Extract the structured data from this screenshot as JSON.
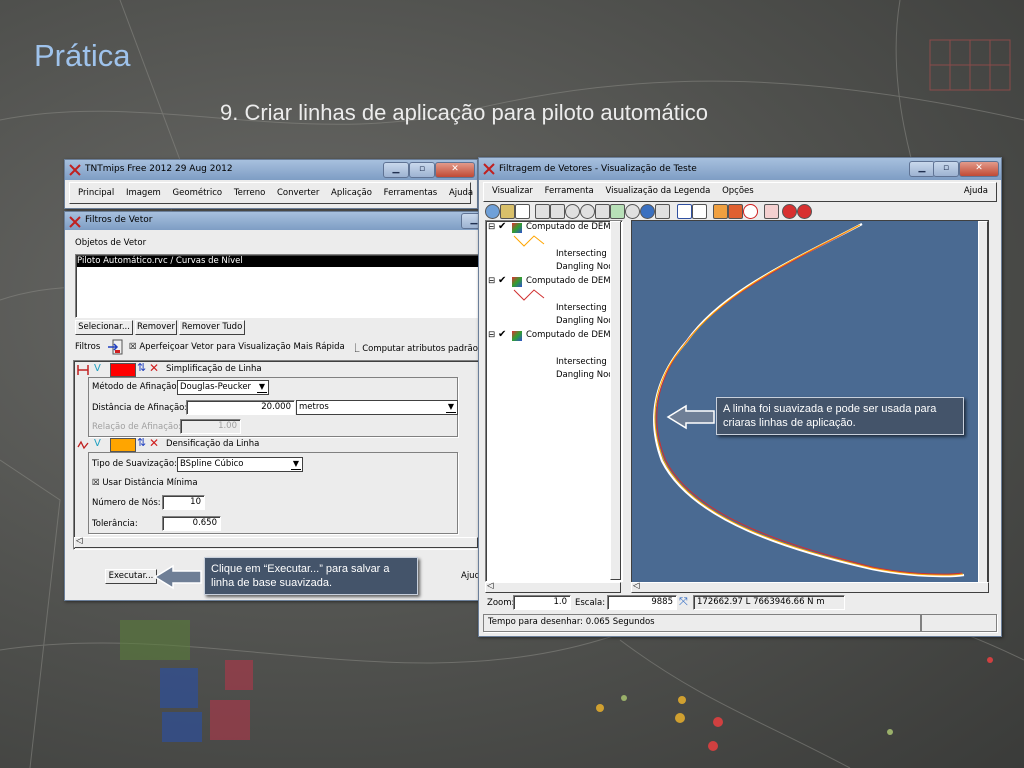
{
  "slide": {
    "title": "Prática",
    "subtitle": "9. Criar linhas de aplicação para piloto automático"
  },
  "tnt_window": {
    "title": "TNTmips Free 2012   29 Aug 2012",
    "menu": [
      "Principal",
      "Imagem",
      "Geométrico",
      "Terreno",
      "Converter",
      "Aplicação",
      "Ferramentas",
      "Ajuda"
    ]
  },
  "filter_window": {
    "title": "Filtros de Vetor",
    "objects_label": "Objetos de Vetor",
    "selected_object": "Piloto Automático.rvc / Curvas de Nível",
    "select_button": "Selecionar...",
    "remove_button": "Remover",
    "remove_all_button": "Remover Tudo",
    "filters_label": "Filtros",
    "improve_check": "Aperfeiçoar Vetor para Visualização Mais Rápida",
    "compute_check": "Computar atributos padrão",
    "simplification": {
      "title": "Simplificação de Linha",
      "method_label": "Método de Afinação:",
      "method_value": "Douglas-Peucker",
      "distance_label": "Distância de Afinação:",
      "distance_value": "20.000",
      "unit_value": "metros",
      "ratio_label": "Relação de Afinação:",
      "ratio_value": "1.00",
      "color": "#ff0000"
    },
    "densification": {
      "title": "Densificação da Linha",
      "type_label": "Tipo de Suavização:",
      "type_value": "BSpline Cúbico",
      "min_dist_check": "Usar Distância Mínima",
      "nodes_label": "Número de Nós:",
      "nodes_value": "10",
      "tolerance_label": "Tolerância:",
      "tolerance_value": "0.650",
      "color": "#ffa500"
    },
    "run_button": "Executar...",
    "help_button": "Ajud"
  },
  "view_window": {
    "title": "Filtragem de Vetores - Visualização de Teste",
    "menu": [
      "Visualizar",
      "Ferramenta",
      "Visualização da Legenda",
      "Opções"
    ],
    "help_menu": "Ajuda",
    "legend": [
      {
        "layer": "Computado de DEM",
        "items": [
          "Intersecting N",
          "Dangling Nod"
        ],
        "line_color": "#ffa500"
      },
      {
        "layer": "Computado de DEM",
        "items": [
          "Intersecting N",
          "Dangling Nod"
        ],
        "line_color": "#d03030"
      },
      {
        "layer": "Computado de DEM",
        "items": [
          "Intersecting N",
          "Dangling Nod"
        ],
        "line_color": "#ffffff"
      }
    ],
    "zoom_label": "Zoom:",
    "zoom_value": "1.0",
    "scale_label": "Escala:",
    "scale_value": "9885",
    "coords_value": "172662.97 L  7663946.66 N m",
    "status_text": "Tempo para desenhar: 0.065 Segundos",
    "map_color": "#4a6a92"
  },
  "callouts": {
    "run_note": "Clique em “Executar...” para salvar a linha de base suavizada.",
    "map_note": "A linha foi suavizada e pode ser usada para criaras linhas de aplicação."
  }
}
